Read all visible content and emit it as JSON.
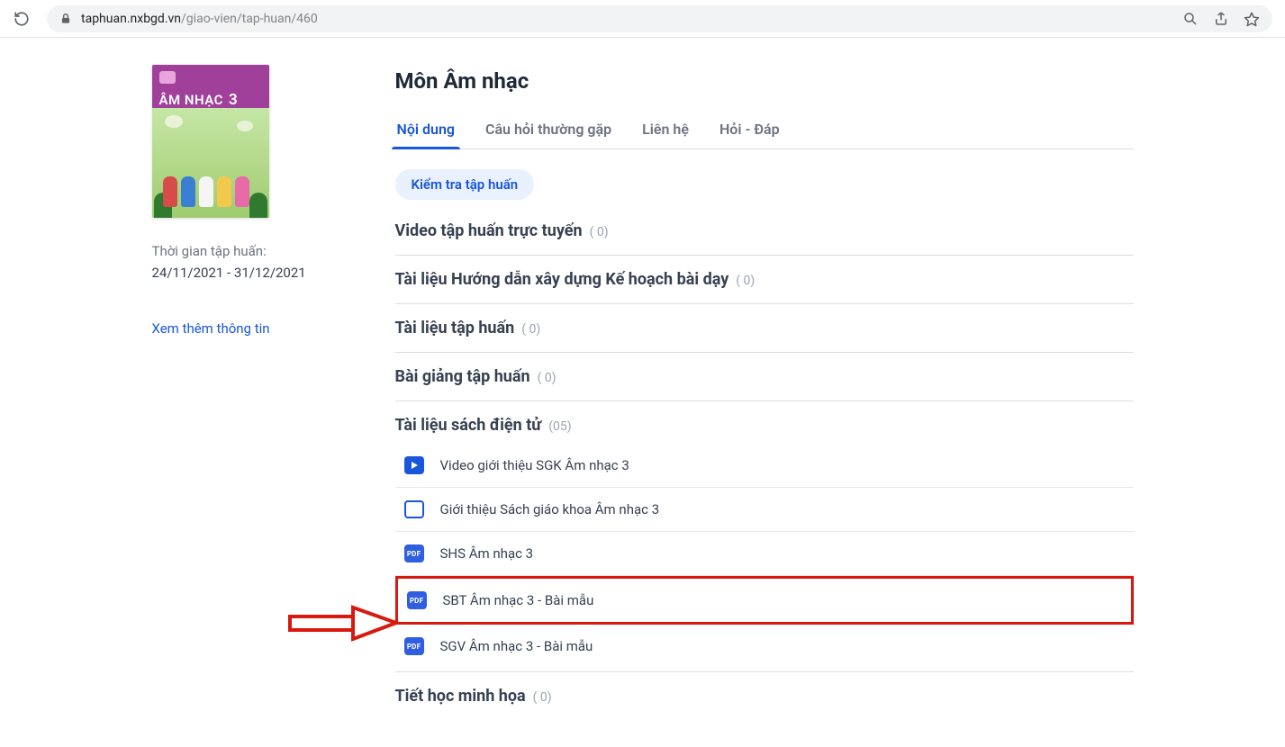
{
  "browser": {
    "url_host": "taphuan.nxbgd.vn",
    "url_path": "/giao-vien/tap-huan/460"
  },
  "cover": {
    "subject": "ÂM NHẠC",
    "grade": "3"
  },
  "sidebar": {
    "time_label": "Thời gian tập huấn:",
    "time_range": "24/11/2021 - 31/12/2021",
    "more_link": "Xem thêm thông tin"
  },
  "main": {
    "title": "Môn Âm nhạc",
    "tabs": [
      "Nội dung",
      "Câu hỏi thường gặp",
      "Liên hệ",
      "Hỏi - Đáp"
    ],
    "pill_button": "Kiểm tra tập huấn",
    "sections": [
      {
        "title": "Video tập huấn trực tuyến",
        "count": "( 0)"
      },
      {
        "title": "Tài liệu Hướng dẫn xây dựng Kế hoạch bài dạy",
        "count": "( 0)"
      },
      {
        "title": "Tài liệu tập huấn",
        "count": "( 0)"
      },
      {
        "title": "Bài giảng tập huấn",
        "count": "( 0)"
      },
      {
        "title": "Tài liệu sách điện tử",
        "count": "(05)"
      },
      {
        "title": "Tiết học minh họa",
        "count": "( 0)"
      }
    ],
    "resources": [
      {
        "icon": "video",
        "label": "Video giới thiệu SGK Âm nhạc 3"
      },
      {
        "icon": "slide",
        "label": "Giới thiệu Sách giáo khoa Âm nhạc 3"
      },
      {
        "icon": "pdf",
        "label": "SHS Âm nhạc 3"
      },
      {
        "icon": "pdf",
        "label": "SBT Âm nhạc 3 - Bài mẫu"
      },
      {
        "icon": "pdf",
        "label": "SGV Âm nhạc 3 - Bài mẫu"
      }
    ]
  }
}
